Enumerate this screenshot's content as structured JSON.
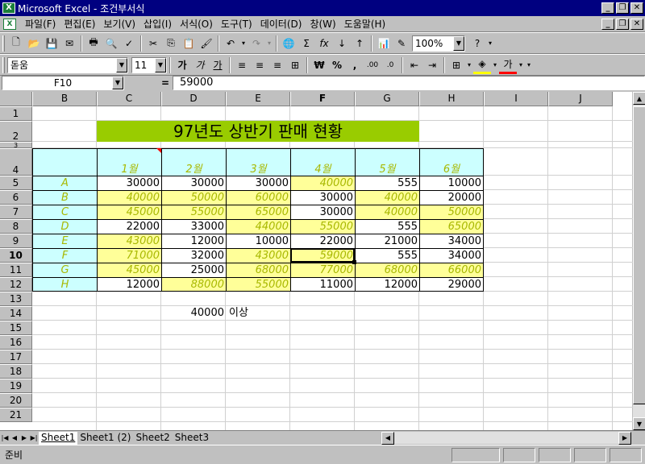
{
  "window": {
    "title": "Microsoft Excel - 조건부서식",
    "app_icon": "excel-icon"
  },
  "menu": {
    "items": [
      "파일(F)",
      "편집(E)",
      "보기(V)",
      "삽입(I)",
      "서식(O)",
      "도구(T)",
      "데이터(D)",
      "창(W)",
      "도움말(H)"
    ]
  },
  "toolbar": {
    "zoom": "100%"
  },
  "format": {
    "font": "돋움",
    "size": "11"
  },
  "formula": {
    "cell_ref": "F10",
    "equals": "=",
    "value": "59000"
  },
  "columns": [
    "B",
    "C",
    "D",
    "E",
    "F",
    "G",
    "H",
    "I",
    "J"
  ],
  "rows": [
    "1",
    "2",
    "3",
    "4",
    "5",
    "6",
    "7",
    "8",
    "9",
    "10",
    "11",
    "12",
    "13",
    "14",
    "15",
    "16",
    "17",
    "18",
    "19",
    "20",
    "21"
  ],
  "table": {
    "title": "97년도 상반기 판매 현황",
    "months": [
      "1월",
      "2월",
      "3월",
      "4월",
      "5월",
      "6월"
    ],
    "data": [
      {
        "label": "A",
        "values": [
          "30000",
          "30000",
          "30000",
          "40000",
          "555",
          "10000"
        ]
      },
      {
        "label": "B",
        "values": [
          "40000",
          "50000",
          "60000",
          "30000",
          "40000",
          "20000"
        ]
      },
      {
        "label": "C",
        "values": [
          "45000",
          "55000",
          "65000",
          "30000",
          "40000",
          "50000"
        ]
      },
      {
        "label": "D",
        "values": [
          "22000",
          "33000",
          "44000",
          "55000",
          "555",
          "65000"
        ]
      },
      {
        "label": "E",
        "values": [
          "43000",
          "12000",
          "10000",
          "22000",
          "21000",
          "34000"
        ]
      },
      {
        "label": "F",
        "values": [
          "71000",
          "32000",
          "43000",
          "59000",
          "555",
          "34000"
        ]
      },
      {
        "label": "G",
        "values": [
          "45000",
          "25000",
          "68000",
          "77000",
          "68000",
          "66000"
        ]
      },
      {
        "label": "H",
        "values": [
          "12000",
          "88000",
          "55000",
          "11000",
          "12000",
          "29000"
        ]
      }
    ]
  },
  "criteria": {
    "value": "40000",
    "label": "이상"
  },
  "sheets": {
    "tabs": [
      "Sheet1",
      "Sheet1 (2)",
      "Sheet2",
      "Sheet3"
    ],
    "active": "Sheet1"
  },
  "status": {
    "text": "준비"
  },
  "colors": {
    "title_fill": "#99cc00",
    "header_fill": "#ccffff",
    "highlight_fill": "#ffff99",
    "highlight_text": "#a8b800"
  }
}
